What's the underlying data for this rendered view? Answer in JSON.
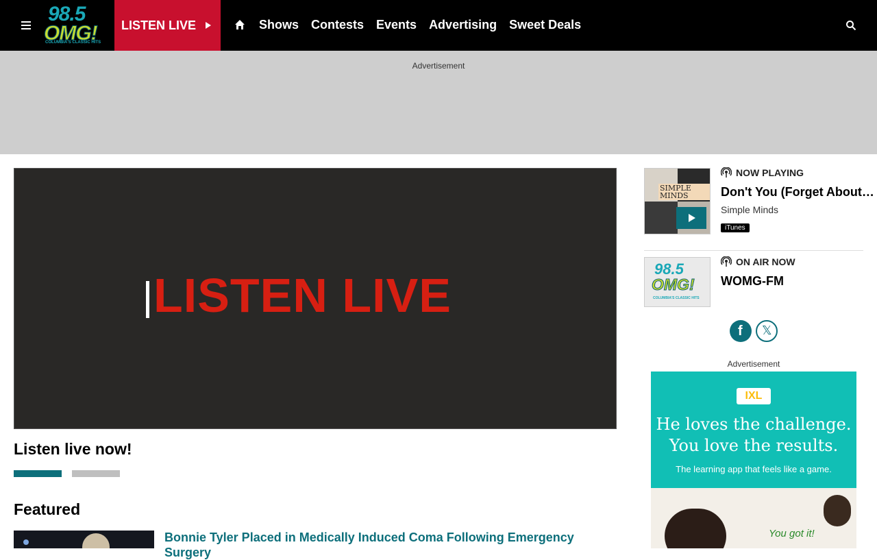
{
  "header": {
    "logo": {
      "number": "98.5",
      "brand": "OMG!",
      "tagline": "COLUMBIA'S CLASSIC HITS"
    },
    "listen_live": "LISTEN LIVE",
    "nav": [
      "Shows",
      "Contests",
      "Events",
      "Advertising",
      "Sweet Deals"
    ]
  },
  "ad_band": {
    "label": "Advertisement"
  },
  "main": {
    "player_text": "LISTEN LIVE",
    "subhead": "Listen live now!",
    "carousel_position": 1,
    "featured_heading": "Featured",
    "featured_title": "Bonnie Tyler Placed in Medically Induced Coma Following Emergency Surgery"
  },
  "sidebar": {
    "now_playing": {
      "label": "NOW PLAYING",
      "song": "Don't You (Forget About Me)",
      "artist": "Simple Minds",
      "album_art_text": "SIMPLE MINDS",
      "store": "iTunes"
    },
    "on_air": {
      "label": "ON AIR NOW",
      "station": "WOMG-FM",
      "logo": {
        "number": "98.5",
        "brand": "OMG!",
        "tagline": "COLUMBIA'S CLASSIC HITS"
      }
    },
    "social": {
      "facebook": "f",
      "x": "𝕏"
    },
    "ad": {
      "label": "Advertisement",
      "brand": "IXL",
      "headline1": "He loves the challenge.",
      "headline2": "You love the results.",
      "tagline": "The learning app that feels like a game.",
      "callout": "You got it!"
    }
  },
  "colors": {
    "accent": "#0d6f7b",
    "listen_red": "#c8102e",
    "brand_lime": "#c8dc2e",
    "brand_teal": "#1aa8b7",
    "ad_teal": "#11bfb5"
  }
}
